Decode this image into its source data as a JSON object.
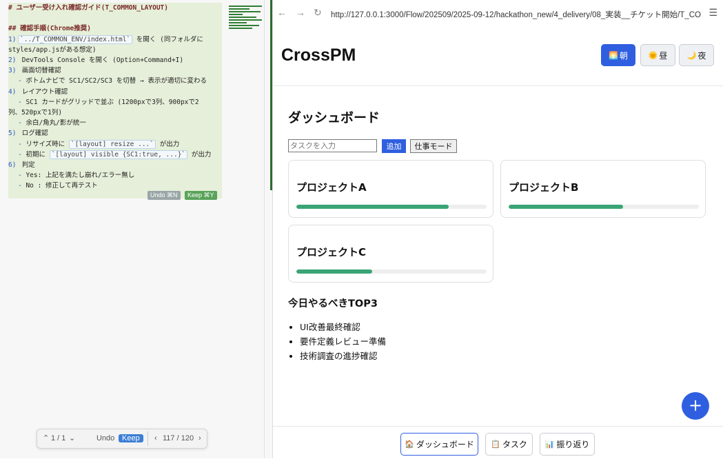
{
  "editor": {
    "lines": [
      {
        "parts": [
          {
            "c": "h",
            "t": "# ユーザー受け入れ確認ガイド(T_COMMON_LAYOUT)"
          }
        ]
      },
      {
        "parts": []
      },
      {
        "parts": [
          {
            "c": "h",
            "t": "## 確認手順(Chrome推奨)"
          }
        ]
      },
      {
        "parts": [
          {
            "c": "ln",
            "t": "1)"
          },
          {
            "c": "code",
            "t": "`../T_COMMON_ENV/index.html`"
          },
          {
            "c": "t",
            "t": " を開く (同フォルダに"
          }
        ]
      },
      {
        "parts": [
          {
            "c": "t",
            "t": "styles/app.jsがある想定)"
          }
        ]
      },
      {
        "parts": [
          {
            "c": "ln",
            "t": "2)"
          },
          {
            "c": "t",
            "t": " DevTools Console を開く (Option+Command+I)"
          }
        ]
      },
      {
        "parts": [
          {
            "c": "ln",
            "t": "3)"
          },
          {
            "c": "t",
            "t": " 画面切替確認"
          }
        ]
      },
      {
        "parts": [
          {
            "c": "dash",
            "t": "- "
          },
          {
            "c": "t",
            "t": "ボトムナビで SC1/SC2/SC3 を切替 → 表示が適切に変わる"
          }
        ]
      },
      {
        "parts": [
          {
            "c": "ln",
            "t": "4)"
          },
          {
            "c": "t",
            "t": " レイアウト確認"
          }
        ]
      },
      {
        "parts": [
          {
            "c": "dash",
            "t": "- "
          },
          {
            "c": "t",
            "t": "SC1 カードがグリッドで並ぶ (1200pxで3列、900pxで2"
          }
        ]
      },
      {
        "parts": [
          {
            "c": "t",
            "t": "列、520pxで1列)"
          }
        ]
      },
      {
        "parts": [
          {
            "c": "dash",
            "t": "- "
          },
          {
            "c": "t",
            "t": "余白/角丸/影が統一"
          }
        ]
      },
      {
        "parts": [
          {
            "c": "ln",
            "t": "5)"
          },
          {
            "c": "t",
            "t": " ログ確認"
          }
        ]
      },
      {
        "parts": [
          {
            "c": "dash",
            "t": "- "
          },
          {
            "c": "t",
            "t": "リサイズ時に "
          },
          {
            "c": "code",
            "t": "`[layout] resize ...`"
          },
          {
            "c": "t",
            "t": " が出力"
          }
        ]
      },
      {
        "parts": [
          {
            "c": "dash",
            "t": "- "
          },
          {
            "c": "t",
            "t": "初期に "
          },
          {
            "c": "code",
            "t": "`[layout] visible {SC1:true, ...}`"
          },
          {
            "c": "t",
            "t": " が出力"
          }
        ]
      },
      {
        "parts": [
          {
            "c": "ln",
            "t": "6)"
          },
          {
            "c": "t",
            "t": " 判定"
          }
        ]
      },
      {
        "parts": [
          {
            "c": "dash",
            "t": "- "
          },
          {
            "c": "t",
            "t": "Yes: 上記を満たし崩れ/エラー無し"
          }
        ]
      },
      {
        "parts": [
          {
            "c": "dash",
            "t": "- "
          },
          {
            "c": "t",
            "t": "No : 修正して再テスト"
          }
        ]
      }
    ],
    "undo_chip": "Undo ⌘N",
    "keep_chip": "Keep ⌘Y"
  },
  "findbar": {
    "counter": "1 / 1",
    "undo": "Undo",
    "keep": "Keep",
    "pages": "117 / 120"
  },
  "browser": {
    "url": "http://127.0.0.1:3000/Flow/202509/2025-09-12/hackathon_new/4_delivery/08_実装__チケット開始/T_CO"
  },
  "app": {
    "title": "CrossPM",
    "theme_buttons": [
      {
        "icon": "🌅",
        "label": "朝"
      },
      {
        "icon": "🌞",
        "label": "昼"
      },
      {
        "icon": "🌙",
        "label": "夜"
      }
    ],
    "page_title": "ダッシュボード",
    "task_placeholder": "タスクを入力",
    "add_label": "追加",
    "work_mode_label": "仕事モード",
    "projects": [
      {
        "name": "プロジェクトA",
        "progress": 0.8
      },
      {
        "name": "プロジェクトB",
        "progress": 0.6
      },
      {
        "name": "プロジェクトC",
        "progress": 0.4
      }
    ],
    "top3_title": "今日やるべきTOP3",
    "top3": [
      "UI改善最終確認",
      "要件定義レビュー準備",
      "技術調査の進捗確認"
    ],
    "fab_label": "+",
    "bottom_nav": [
      {
        "icon": "🏠",
        "label": "ダッシュボード"
      },
      {
        "icon": "📋",
        "label": "タスク"
      },
      {
        "icon": "📊",
        "label": "振り返り"
      }
    ]
  },
  "colors": {
    "accent": "#2f5fe0",
    "progress": "#3aa475"
  }
}
